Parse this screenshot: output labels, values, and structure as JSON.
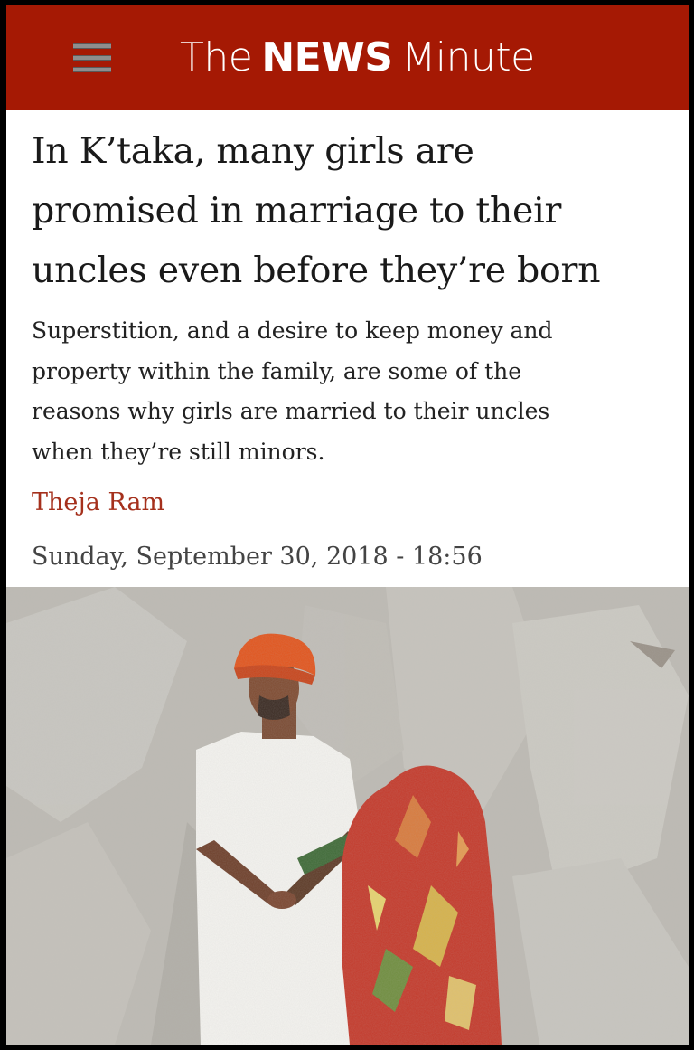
{
  "header": {
    "brand_color": "#a51904",
    "menu_icon": "hamburger-menu-icon",
    "logo": {
      "the": "The",
      "news": "NEWS",
      "minute": "Minute"
    }
  },
  "article": {
    "headline_lines": [
      "In K’taka, many girls are",
      "promised in marriage to their",
      "uncles even before they’re born"
    ],
    "subhead_lines": [
      "Superstition, and a desire to keep money and",
      "property within the family, are some of the",
      "reasons why girls are married to their uncles",
      "when they’re still minors."
    ],
    "author": "Theja Ram",
    "author_color": "#a5301c",
    "date": "Sunday, September 30, 2018 - 18:56"
  },
  "hero_image": {
    "description_icon": "illustration-man-in-turban-and-bride-in-red-saree",
    "colors": {
      "turban": "#e2541c",
      "saree": "#c4392a",
      "background": "#bdbab3"
    }
  }
}
